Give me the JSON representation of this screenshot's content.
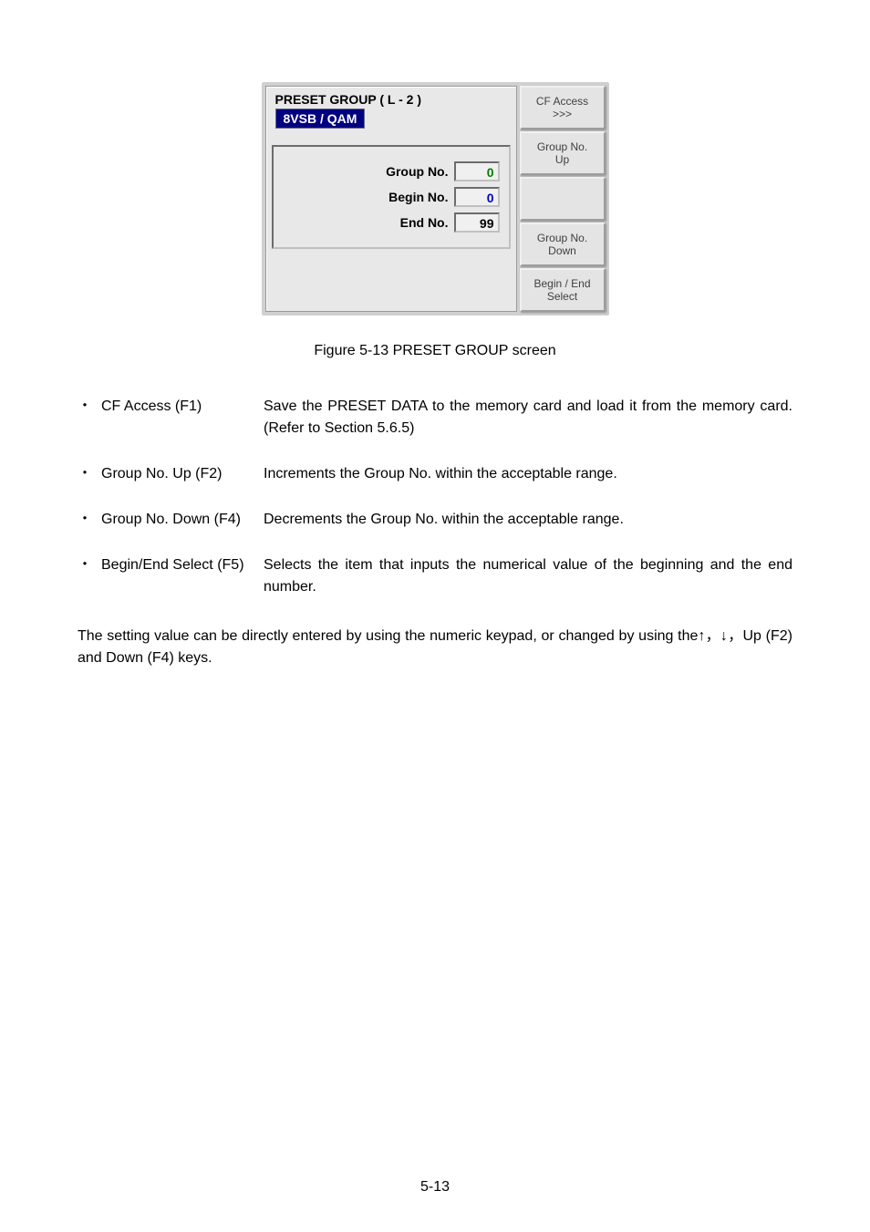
{
  "screen": {
    "title": "PRESET GROUP ( L - 2 )",
    "mode": "8VSB / QAM",
    "inputs": {
      "group_no_label": "Group No.",
      "group_no_value": "0",
      "begin_no_label": "Begin No.",
      "begin_no_value": "0",
      "end_no_label": "End No.",
      "end_no_value": "99"
    },
    "softkeys": {
      "f1_line1": "CF Access",
      "f1_line2": ">>>",
      "f2_line1": "Group No.",
      "f2_line2": "Up",
      "f4_line1": "Group No.",
      "f4_line2": "Down",
      "f5_line1": "Begin / End",
      "f5_line2": "Select"
    }
  },
  "figure_caption": "Figure 5-13    PRESET GROUP screen",
  "items": [
    {
      "label": "CF Access (F1)",
      "desc": "Save the PRESET DATA to the memory card and load it from the memory card. (Refer to Section 5.6.5)"
    },
    {
      "label": "Group No. Up (F2)",
      "desc": "Increments the Group No. within the acceptable range."
    },
    {
      "label": "Group No. Down (F4)",
      "desc": "Decrements the Group No. within the acceptable range."
    },
    {
      "label": "Begin/End Select (F5)",
      "desc": "Selects the item that inputs the numerical value of the beginning and the end number."
    }
  ],
  "body": "The setting value can be directly entered by using the numeric keypad, or changed by using the↑，↓，Up (F2) and Down (F4) keys.",
  "page_num": "5-13"
}
